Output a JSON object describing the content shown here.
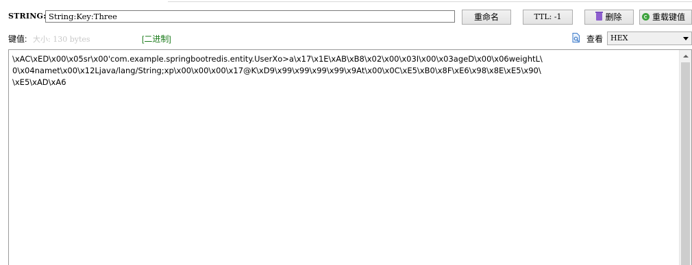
{
  "header": {
    "type_label": "STRING:",
    "key_value": "String:Key:Three",
    "rename_label": "重命名",
    "ttl_label": "TTL: -1",
    "delete_label": "删除",
    "reload_label": "重载键值"
  },
  "value_bar": {
    "value_label": "键值:",
    "size_label": "大小: 130 bytes",
    "binary_label": "[二进制]",
    "view_label": "查看",
    "format_selected": "HEX"
  },
  "value": {
    "line1": "\\xAC\\xED\\x00\\x05sr\\x00'com.example.springbootredis.entity.UserXo>a\\x17\\x1E\\xAB\\xB8\\x02\\x00\\x03I\\x00\\x03ageD\\x00\\x06weightL\\",
    "line2": "0\\x04namet\\x00\\x12Ljava/lang/String;xp\\x00\\x00\\x00\\x17@K\\xD9\\x99\\x99\\x99\\x99\\x9At\\x00\\x0C\\xE5\\xB0\\x8F\\xE6\\x98\\x8E\\xE5\\x90\\",
    "line3": "\\xE5\\xAD\\xA6"
  },
  "icons": {
    "delete": "trash-icon",
    "reload": "reload-icon",
    "view": "file-view-icon",
    "dropdown": "chevron-down-icon"
  }
}
